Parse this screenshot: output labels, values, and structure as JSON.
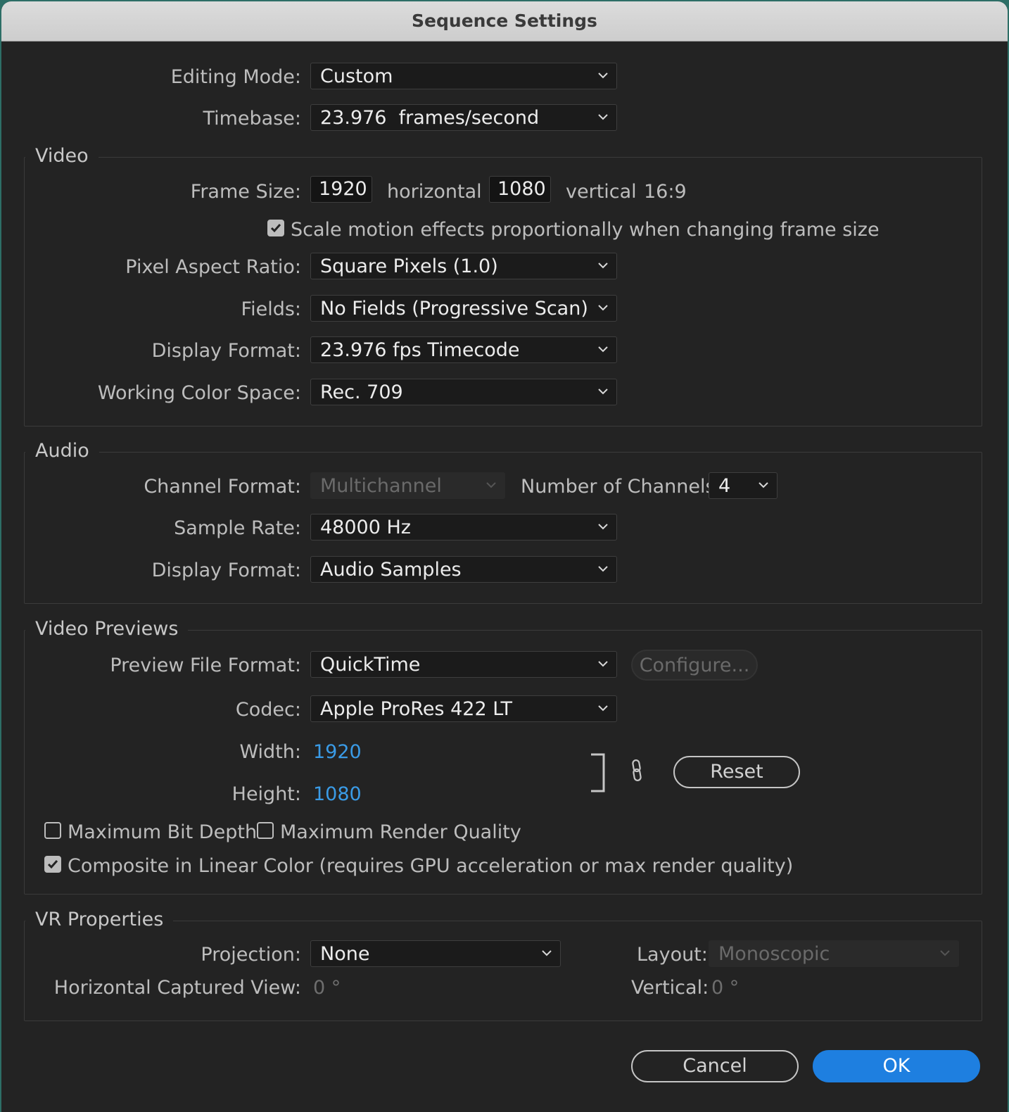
{
  "window": {
    "title": "Sequence Settings"
  },
  "editing_mode": {
    "label": "Editing Mode:",
    "value": "Custom"
  },
  "timebase": {
    "label": "Timebase:",
    "value": "23.976  frames/second"
  },
  "video": {
    "section_title": "Video",
    "frame_size": {
      "label": "Frame Size:",
      "horizontal_value": "1920",
      "horizontal_label": "horizontal",
      "vertical_value": "1080",
      "vertical_label": "vertical",
      "aspect": "16:9"
    },
    "scale_motion": {
      "label": "Scale motion effects proportionally when changing frame size",
      "checked": true
    },
    "pixel_aspect_ratio": {
      "label": "Pixel Aspect Ratio:",
      "value": "Square Pixels (1.0)"
    },
    "fields": {
      "label": "Fields:",
      "value": "No Fields (Progressive Scan)"
    },
    "display_format": {
      "label": "Display Format:",
      "value": "23.976 fps Timecode"
    },
    "working_color_space": {
      "label": "Working Color Space:",
      "value": "Rec. 709"
    }
  },
  "audio": {
    "section_title": "Audio",
    "channel_format": {
      "label": "Channel Format:",
      "value": "Multichannel",
      "disabled": true
    },
    "number_of_channels": {
      "label": "Number of Channels:",
      "value": "4"
    },
    "sample_rate": {
      "label": "Sample Rate:",
      "value": "48000 Hz"
    },
    "display_format": {
      "label": "Display Format:",
      "value": "Audio Samples"
    }
  },
  "video_previews": {
    "section_title": "Video Previews",
    "preview_file_format": {
      "label": "Preview File Format:",
      "value": "QuickTime"
    },
    "configure_label": "Configure...",
    "codec": {
      "label": "Codec:",
      "value": "Apple ProRes 422 LT"
    },
    "width": {
      "label": "Width:",
      "value": "1920"
    },
    "height": {
      "label": "Height:",
      "value": "1080"
    },
    "reset_label": "Reset",
    "max_bit_depth": {
      "label": "Maximum Bit Depth",
      "checked": false
    },
    "max_render_quality": {
      "label": "Maximum Render Quality",
      "checked": false
    },
    "composite_linear": {
      "label": "Composite in Linear Color (requires GPU acceleration or max render quality)",
      "checked": true
    }
  },
  "vr_properties": {
    "section_title": "VR Properties",
    "projection": {
      "label": "Projection:",
      "value": "None"
    },
    "layout": {
      "label": "Layout:",
      "value": "Monoscopic",
      "disabled": true
    },
    "horizontal_captured_view": {
      "label": "Horizontal Captured View:",
      "value": "0 °"
    },
    "vertical": {
      "label": "Vertical:",
      "value": "0 °"
    }
  },
  "buttons": {
    "cancel": "Cancel",
    "ok": "OK"
  },
  "colors": {
    "accent": "#1e7fe0",
    "link": "#3a9be6",
    "background": "#232323"
  },
  "icons": [
    "chevron-down-icon",
    "checkmark-icon",
    "chain-link-icon",
    "link-bracket-icon"
  ]
}
